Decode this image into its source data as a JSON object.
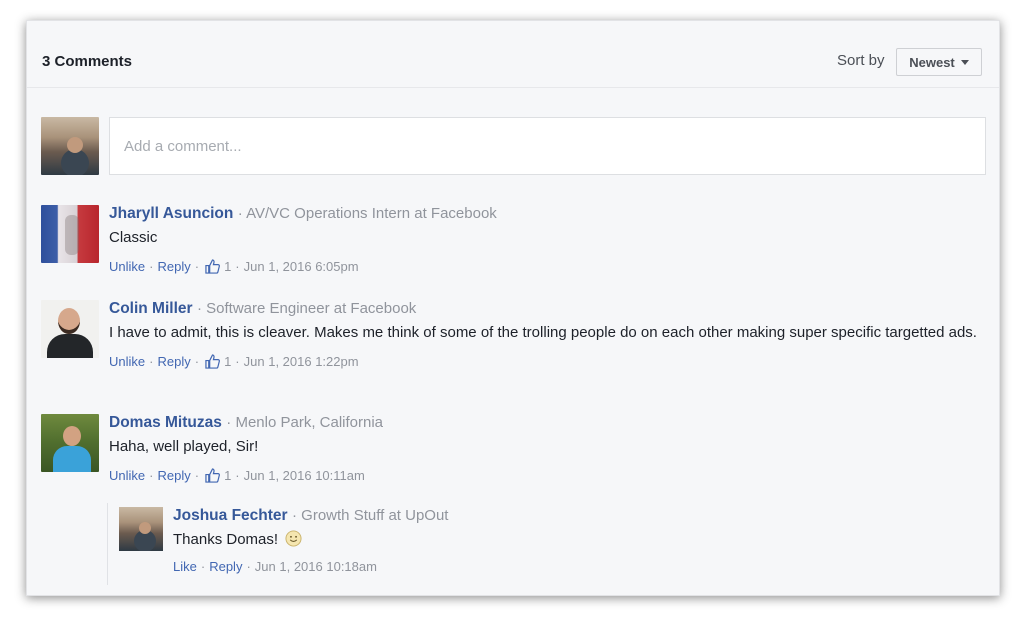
{
  "header": {
    "count_label": "3 Comments",
    "sort_label": "Sort by",
    "sort_value": "Newest"
  },
  "composer": {
    "placeholder": "Add a comment..."
  },
  "comments": [
    {
      "author": "Jharyll Asuncion",
      "meta": "· AV/VC Operations Intern at Facebook",
      "text": "Classic",
      "unlike": "Unlike",
      "reply": "Reply",
      "likes": "1",
      "time": "Jun 1, 2016 6:05pm"
    },
    {
      "author": "Colin Miller",
      "meta": "· Software Engineer at Facebook",
      "text": "I have to admit, this is cleaver. Makes me think of some of the trolling people do on each other making super specific targetted ads.",
      "unlike": "Unlike",
      "reply": "Reply",
      "likes": "1",
      "time": "Jun 1, 2016 1:22pm"
    },
    {
      "author": "Domas Mituzas",
      "meta": "· Menlo Park, California",
      "text": "Haha, well played, Sir!",
      "unlike": "Unlike",
      "reply": "Reply",
      "likes": "1",
      "time": "Jun 1, 2016 10:11am"
    }
  ],
  "reply": {
    "author": "Joshua Fechter",
    "meta": "· Growth Stuff at UpOut",
    "text": "Thanks Domas!",
    "emoji_icon": "smiley-icon",
    "like": "Like",
    "reply": "Reply",
    "time": "Jun 1, 2016 10:18am"
  },
  "colors": {
    "link": "#365899",
    "muted": "#90949c",
    "text": "#1d2129"
  }
}
